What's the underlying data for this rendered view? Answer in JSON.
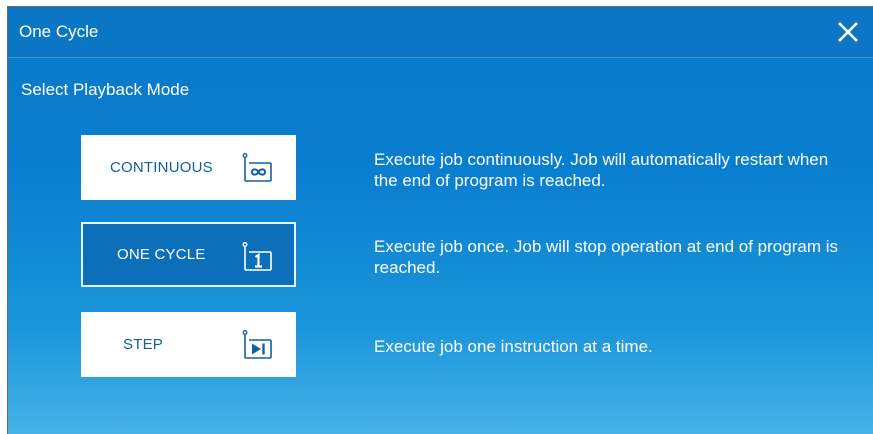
{
  "dialog": {
    "title": "One Cycle",
    "close_icon": "close-icon",
    "subtitle": "Select Playback Mode"
  },
  "modes": [
    {
      "label": "CONTINUOUS",
      "icon": "continuous-infinity-icon",
      "description": "Execute job continuously. Job will automatically restart when the end of program is reached.",
      "selected": false
    },
    {
      "label": "ONE CYCLE",
      "icon": "one-cycle-icon",
      "description": "Execute job once. Job will stop operation at end of program is reached.",
      "selected": true
    },
    {
      "label": "STEP",
      "icon": "step-icon",
      "description": "Execute job one instruction at a time.",
      "selected": false
    }
  ],
  "colors": {
    "background": "#0a7fcf",
    "button": "#ffffff",
    "button_selected": "#0b6fb9",
    "button_text": "#13609e"
  }
}
